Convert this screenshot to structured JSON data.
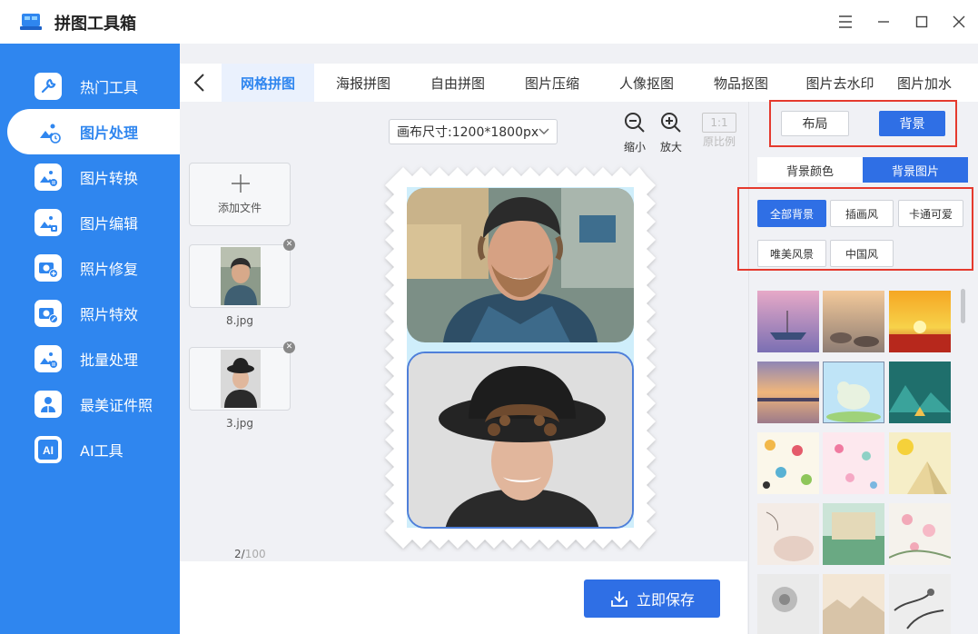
{
  "app": {
    "title": "拼图工具箱"
  },
  "sidebar": {
    "items": [
      {
        "label": "热门工具",
        "icon": "wrench-icon"
      },
      {
        "label": "图片处理",
        "icon": "image-edit-icon",
        "active": true
      },
      {
        "label": "图片转换",
        "icon": "image-convert-icon"
      },
      {
        "label": "图片编辑",
        "icon": "image-edit-doc-icon"
      },
      {
        "label": "照片修复",
        "icon": "camera-plus-icon"
      },
      {
        "label": "照片特效",
        "icon": "camera-magic-icon"
      },
      {
        "label": "批量处理",
        "icon": "image-batch-icon"
      },
      {
        "label": "最美证件照",
        "icon": "id-photo-icon"
      },
      {
        "label": "AI工具",
        "icon": "ai-icon"
      }
    ]
  },
  "tabs": [
    "网格拼图",
    "海报拼图",
    "自由拼图",
    "图片压缩",
    "人像抠图",
    "物品抠图",
    "图片去水印",
    "图片加水"
  ],
  "files": {
    "add_label": "添加文件",
    "items": [
      {
        "name": "8.jpg"
      },
      {
        "name": "3.jpg"
      }
    ],
    "count": "2/",
    "max": "100"
  },
  "canvas": {
    "size_label": "画布尺寸:1200*1800px",
    "zoom_out": "缩小",
    "zoom_in": "放大",
    "ratio_box": "1:1",
    "ratio_label": "原比例"
  },
  "save": {
    "label": "立即保存"
  },
  "right": {
    "mode_buttons": [
      "布局",
      "背景"
    ],
    "sub_tabs": [
      "背景颜色",
      "背景图片"
    ],
    "categories": [
      "全部背景",
      "插画风",
      "卡通可爱",
      "唯美风景",
      "中国风"
    ]
  },
  "colors": {
    "accent": "#2f6fe5",
    "sidebar": "#2f86ef",
    "highlight": "#e53a2e"
  }
}
